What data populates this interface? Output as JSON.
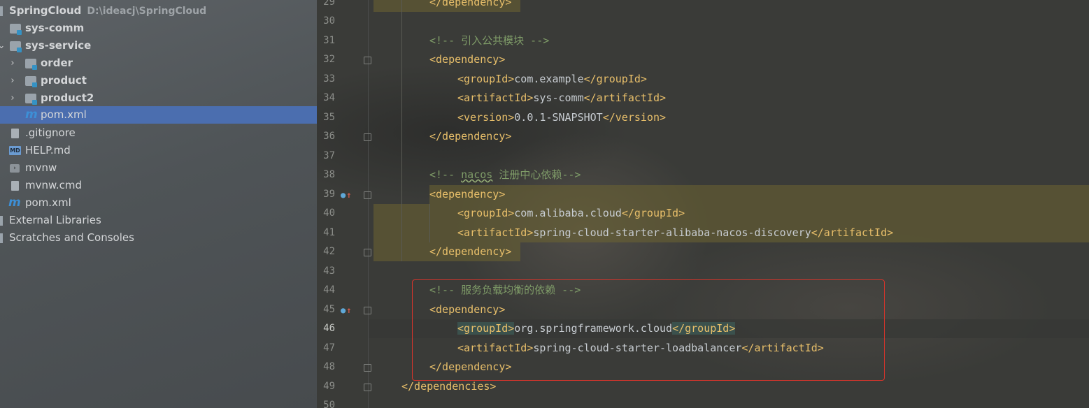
{
  "project": {
    "root": {
      "name": "SpringCloud",
      "path": "D:\\ideacj\\SpringCloud"
    },
    "items": [
      {
        "label": "sys-comm",
        "icon": "module-folder-icon"
      },
      {
        "label": "sys-service",
        "icon": "module-folder-icon"
      },
      {
        "label": "order",
        "icon": "module-folder-icon"
      },
      {
        "label": "product",
        "icon": "module-folder-icon"
      },
      {
        "label": "product2",
        "icon": "module-folder-icon"
      },
      {
        "label": "pom.xml",
        "icon": "maven-icon"
      },
      {
        "label": ".gitignore",
        "icon": "gitignore-file-icon"
      },
      {
        "label": "HELP.md",
        "icon": "markdown-file-icon"
      },
      {
        "label": "mvnw",
        "icon": "terminal-file-icon"
      },
      {
        "label": "mvnw.cmd",
        "icon": "file-icon"
      },
      {
        "label": "pom.xml",
        "icon": "maven-icon"
      },
      {
        "label": "External Libraries",
        "icon": "libraries-icon"
      },
      {
        "label": "Scratches and Consoles",
        "icon": "scratches-icon"
      }
    ],
    "selected": "pom.xml"
  },
  "editor": {
    "line_numbers": [
      "29",
      "30",
      "31",
      "32",
      "33",
      "34",
      "35",
      "36",
      "37",
      "38",
      "39",
      "40",
      "41",
      "42",
      "43",
      "44",
      "45",
      "46",
      "47",
      "48",
      "49",
      "50"
    ],
    "current_line": "46",
    "code": {
      "l29_close": "</dependency>",
      "l31_comment": "<!-- 引入公共模块 -->",
      "dep_open": "<dependency>",
      "dep_close": "</dependency>",
      "g_open": "<groupId>",
      "g_close": "</groupId>",
      "a_open": "<artifactId>",
      "a_close": "</artifactId>",
      "v_open": "<version>",
      "v_close": "</version>",
      "l33_group": "com.example",
      "l34_artifact": "sys-comm",
      "l35_version": "0.0.1-SNAPSHOT",
      "l38_comment_start": "<!-- ",
      "l38_comment_nacos": "nacos",
      "l38_comment_rest": " 注册中心依赖-->",
      "l40_group": "com.alibaba.cloud",
      "l41_artifact": "spring-cloud-starter-alibaba-nacos-discovery",
      "l44_comment": "<!-- 服务负载均衡的依赖 -->",
      "l46_group": "org.springframework.cloud",
      "l47_artifact": "spring-cloud-starter-loadbalancer",
      "l49_close": "</dependencies>"
    }
  },
  "colors": {
    "selection": "#4b6eaf",
    "tag": "#e8bf6a",
    "comment": "#7f9c68",
    "highlight_box": "#d8342b"
  }
}
